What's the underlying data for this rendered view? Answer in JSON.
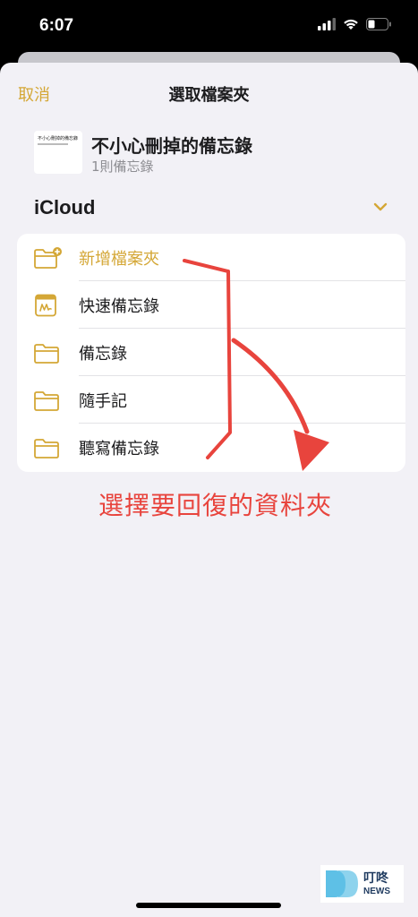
{
  "status": {
    "time": "6:07"
  },
  "nav": {
    "cancel": "取消",
    "title": "選取檔案夾"
  },
  "note": {
    "thumb_text": "不小心刪掉的備忘錄",
    "title": "不小心刪掉的備忘錄",
    "subtitle": "1則備忘錄"
  },
  "account": {
    "name": "iCloud"
  },
  "folders": [
    {
      "label": "新增檔案夾",
      "icon": "new-folder-icon"
    },
    {
      "label": "快速備忘錄",
      "icon": "quick-note-icon"
    },
    {
      "label": "備忘錄",
      "icon": "folder-icon"
    },
    {
      "label": "隨手記",
      "icon": "folder-icon"
    },
    {
      "label": "聽寫備忘錄",
      "icon": "folder-icon"
    }
  ],
  "annotation": {
    "text": "選擇要回復的資料夾"
  },
  "watermark": {
    "line1": "叮咚",
    "line2": "NEWS"
  },
  "colors": {
    "accent": "#d4a736",
    "annotation": "#e8443d"
  }
}
